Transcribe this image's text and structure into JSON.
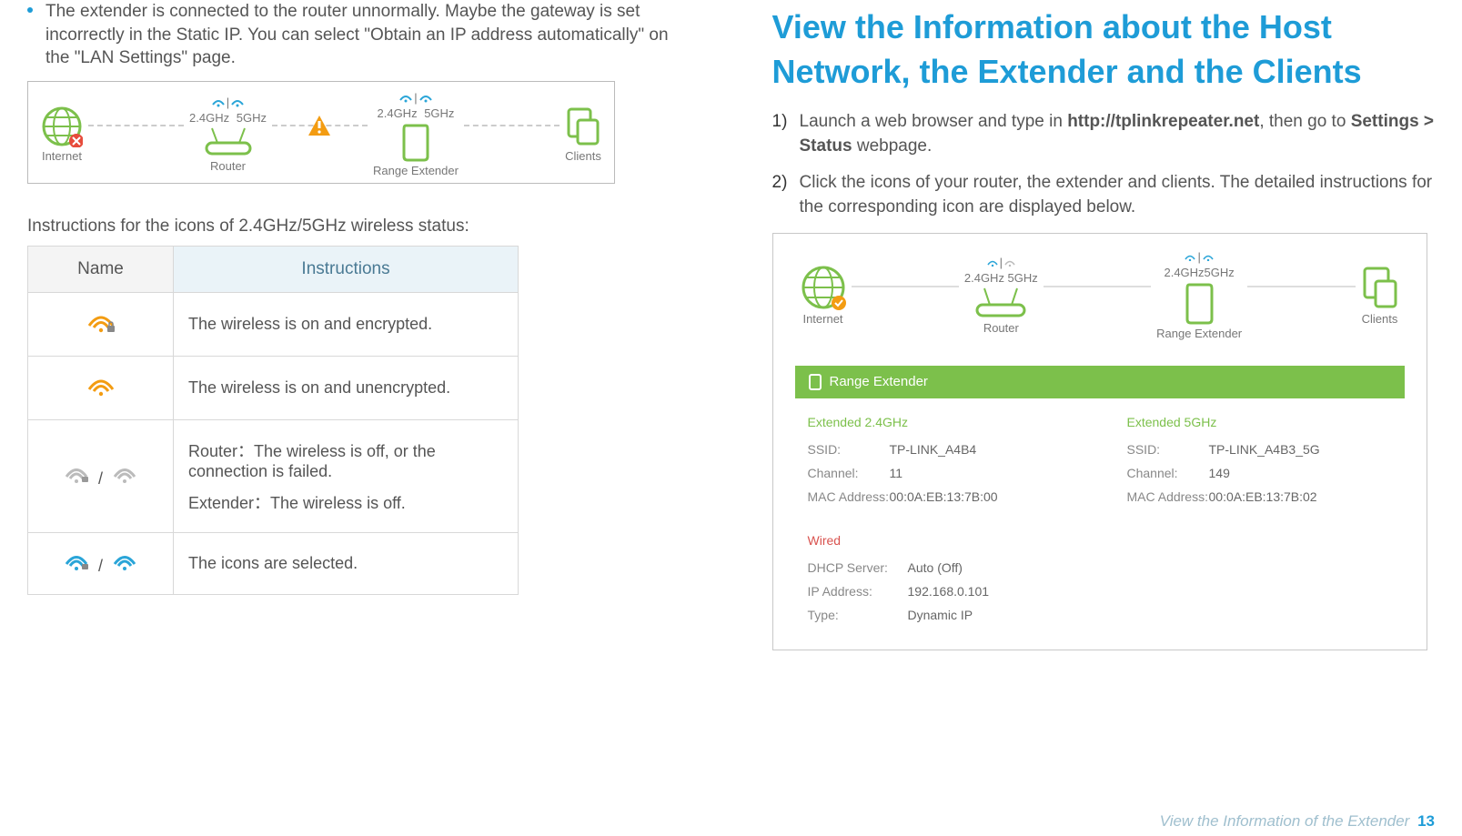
{
  "left": {
    "bullet_text": "The extender is connected to the router unnormally. Maybe the gateway is set incorrectly in the Static IP. You can select \"Obtain an IP address automatically\" on the \"LAN Settings\" page.",
    "topo": {
      "internet": "Internet",
      "router": "Router",
      "rext": "Range Extender",
      "clients": "Clients",
      "freq24": "2.4GHz",
      "freq5": "5GHz"
    },
    "table_intro": "Instructions for the icons of 2.4GHz/5GHz wireless status:",
    "th_name": "Name",
    "th_instr": "Instructions",
    "row1": "The wireless is on and encrypted.",
    "row2": "The wireless is on and unencrypted.",
    "row3a": "Router：The wireless is off, or the connection is failed.",
    "row3b": "Extender：The wireless is off.",
    "row4": "The icons are selected."
  },
  "right": {
    "heading": "View the Information about the Host Network, the Extender and the Clients",
    "step1_a": "Launch a web browser and type in ",
    "step1_b": "http://tplinkrepeater.net",
    "step1_c": ", then go to ",
    "step1_d": "Settings > Status",
    "step1_e": " webpage.",
    "step2": "Click the icons of your router, the extender and clients. The detailed instructions for the corresponding icon are displayed below.",
    "num1": "1)",
    "num2": "2)",
    "panel": {
      "topo": {
        "internet": "Internet",
        "router": "Router",
        "rext": "Range Extender",
        "clients": "Clients",
        "freq_combo": "2.4GHz 5GHz",
        "freq_combo2": "2.4GHz5GHz"
      },
      "bar": "Range Extender",
      "band24": "Extended 2.4GHz",
      "band5": "Extended 5GHz",
      "ssid_k": "SSID:",
      "ssid24_v": "TP-LINK_A4B4",
      "ssid5_v": "TP-LINK_A4B3_5G",
      "chan_k": "Channel:",
      "chan24_v": "11",
      "chan5_v": "149",
      "mac_k": "MAC Address:",
      "mac24_v": "00:0A:EB:13:7B:00",
      "mac5_v": "00:0A:EB:13:7B:02",
      "wired": "Wired",
      "dhcp_k": "DHCP Server:",
      "dhcp_v": "Auto (Off)",
      "ip_k": "IP Address:",
      "ip_v": "192.168.0.101",
      "type_k": "Type:",
      "type_v": "Dynamic IP"
    },
    "footer_text": "View the Information of the Extender",
    "page_num": "13"
  }
}
